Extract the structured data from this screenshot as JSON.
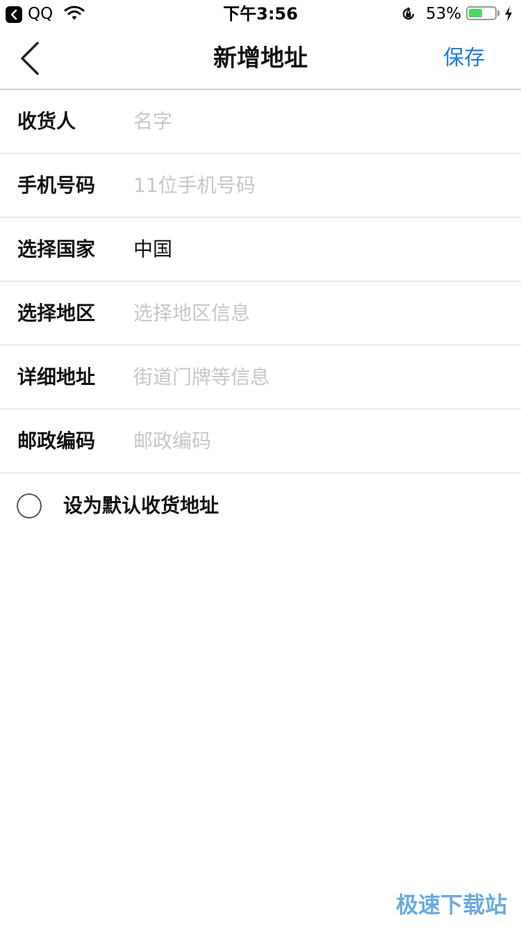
{
  "status_bar": {
    "app_name": "QQ",
    "time": "下午3:56",
    "battery_percent": "53%",
    "battery_level": 0.53
  },
  "nav": {
    "back_icon": "chevron-left-icon",
    "title": "新增地址",
    "save_label": "保存"
  },
  "form": {
    "recipient": {
      "label": "收货人",
      "placeholder": "名字",
      "value": ""
    },
    "phone": {
      "label": "手机号码",
      "placeholder": "11位手机号码",
      "value": ""
    },
    "country": {
      "label": "选择国家",
      "value": "中国"
    },
    "region": {
      "label": "选择地区",
      "placeholder": "选择地区信息"
    },
    "address": {
      "label": "详细地址",
      "placeholder": "街道门牌等信息",
      "value": ""
    },
    "postcode": {
      "label": "邮政编码",
      "placeholder": "邮政编码",
      "value": ""
    }
  },
  "default_address": {
    "label": "设为默认收货地址",
    "checked": false
  },
  "watermark": "极速下载站",
  "colors": {
    "accent": "#1e7ae0",
    "placeholder": "#c6c6cc",
    "battery": "#4cd964"
  }
}
